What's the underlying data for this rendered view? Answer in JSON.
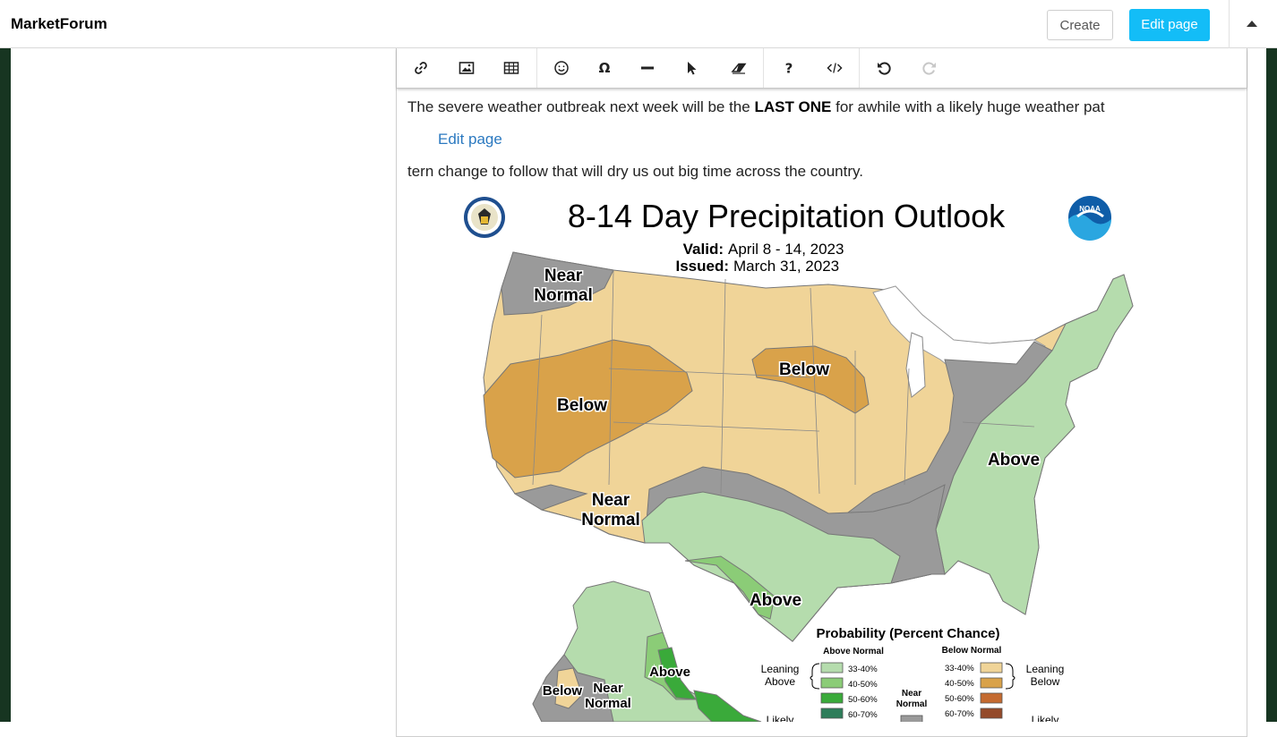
{
  "site": {
    "name": "MarketForum"
  },
  "header": {
    "create_label": "Create",
    "edit_label": "Edit page"
  },
  "toolbar": {
    "icons": [
      "link-icon",
      "image-icon",
      "table-icon",
      "emoji-icon",
      "omega-icon",
      "horizontal-rule-icon",
      "pointer-icon",
      "eraser-icon",
      "help-icon",
      "code-icon",
      "undo-icon",
      "redo-icon"
    ]
  },
  "content": {
    "line1_pre": "The severe weather outbreak next week will be the ",
    "line1_bold": "LAST ONE",
    "line1_post": " for awhile with a likely huge weather pat",
    "edit_link": "Edit page",
    "line2": "tern change to follow that will dry us out big time across the country."
  },
  "map": {
    "title": "8-14 Day Precipitation Outlook",
    "valid_label": "Valid:",
    "valid_value": "April 8 - 14, 2023",
    "issued_label": "Issued:",
    "issued_value": "March 31, 2023",
    "noaa_text": "NOAA",
    "region_labels": {
      "nw": [
        "Near",
        "Normal"
      ],
      "west_below": "Below",
      "north_below": "Below",
      "east_above": "Above",
      "sw": [
        "Near",
        "Normal"
      ],
      "south_above": "Above",
      "ak_above": "Above",
      "ak_below": "Below",
      "ak_nn": [
        "Near",
        "Normal"
      ]
    },
    "legend": {
      "title": "Probability (Percent Chance)",
      "above_header": "Above Normal",
      "below_header": "Below Normal",
      "leaning_above": [
        "Leaning",
        "Above"
      ],
      "leaning_below": [
        "Leaning",
        "Below"
      ],
      "near_normal": [
        "Near",
        "Normal"
      ],
      "likely_left": "Likely",
      "likely_right": "Likely",
      "above_bins": [
        "33-40%",
        "40-50%",
        "50-60%",
        "60-70%"
      ],
      "below_bins": [
        "33-40%",
        "40-50%",
        "50-60%",
        "60-70%"
      ]
    },
    "colors": {
      "lean_below": "#f0d498",
      "below": "#d9a24a",
      "lean_above": "#b5dcad",
      "above": "#8bcc77",
      "above_50": "#3aaa3a",
      "above_60": "#2e7d5a",
      "near_normal": "#9a9a9a",
      "below_50": "#c46a30",
      "below_60": "#944a2a"
    }
  }
}
